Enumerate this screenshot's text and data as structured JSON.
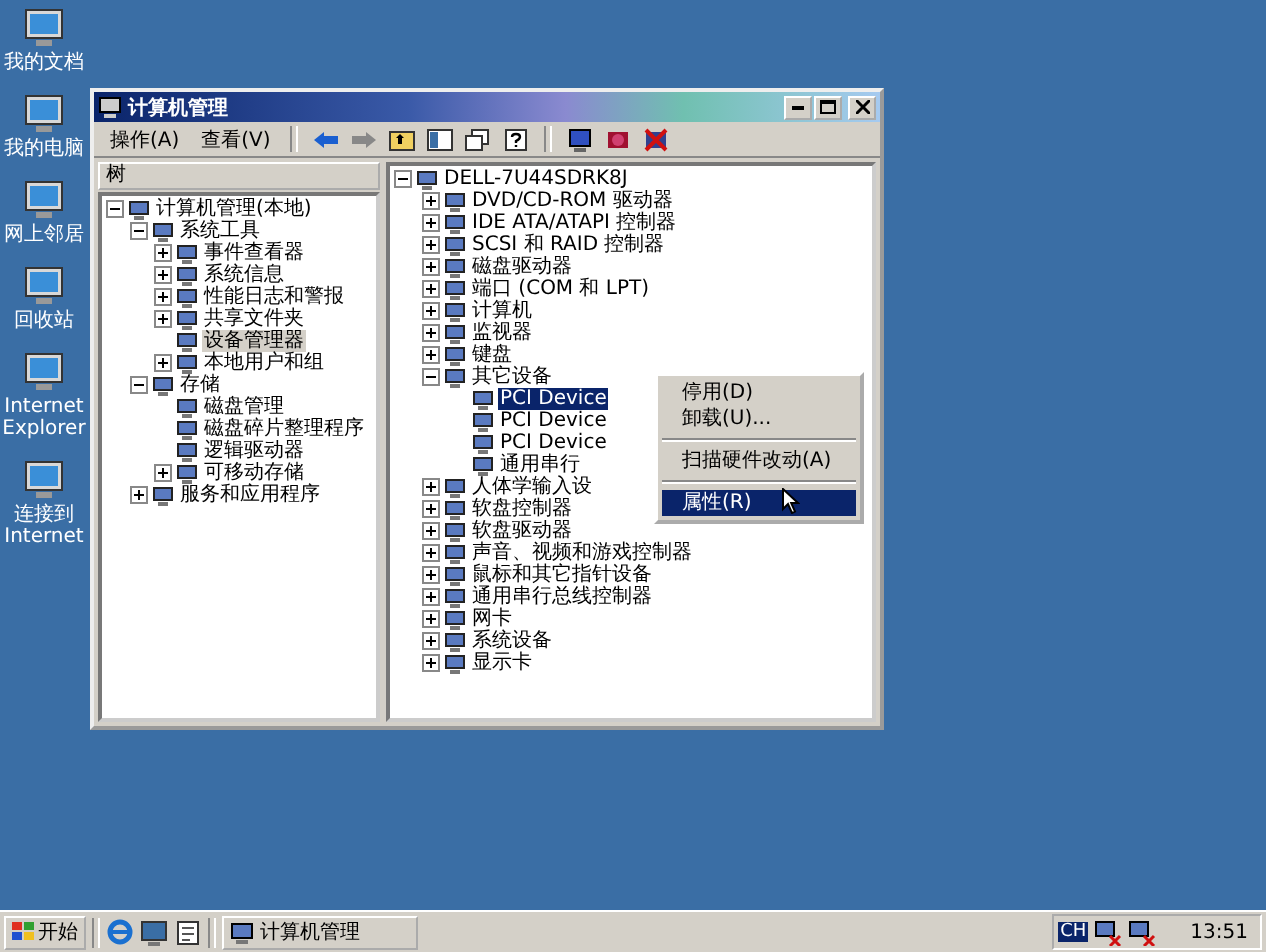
{
  "desktop_icons": [
    {
      "label": "我的文档"
    },
    {
      "label": "我的电脑"
    },
    {
      "label": "网上邻居"
    },
    {
      "label": "回收站"
    },
    {
      "label": "Internet Explorer"
    },
    {
      "label": "连接到 Internet"
    }
  ],
  "window": {
    "title": "计算机管理"
  },
  "menu": [
    "操作(A)",
    "查看(V)"
  ],
  "pane_header": "树",
  "left_tree": [
    {
      "label": "计算机管理(本地)",
      "expanded": true,
      "selected": false,
      "children": [
        {
          "label": "系统工具",
          "expanded": true,
          "selected": false,
          "children": [
            {
              "label": "事件查看器",
              "expanded": false,
              "selected": false
            },
            {
              "label": "系统信息",
              "expanded": false,
              "selected": false
            },
            {
              "label": "性能日志和警报",
              "expanded": false,
              "selected": false
            },
            {
              "label": "共享文件夹",
              "expanded": false,
              "selected": false
            },
            {
              "label": "设备管理器",
              "selected": true
            },
            {
              "label": "本地用户和组",
              "expanded": false,
              "selected": false
            }
          ]
        },
        {
          "label": "存储",
          "expanded": true,
          "selected": false,
          "children": [
            {
              "label": "磁盘管理",
              "selected": false
            },
            {
              "label": "磁盘碎片整理程序",
              "selected": false
            },
            {
              "label": "逻辑驱动器",
              "selected": false
            },
            {
              "label": "可移动存储",
              "expanded": false,
              "selected": false
            }
          ]
        },
        {
          "label": "服务和应用程序",
          "expanded": false,
          "selected": false
        }
      ]
    }
  ],
  "right_tree": [
    {
      "label": "DELL-7U44SDRK8J",
      "expanded": true,
      "selected": false,
      "children": [
        {
          "label": "DVD/CD-ROM 驱动器",
          "expanded": false,
          "selected": false
        },
        {
          "label": "IDE ATA/ATAPI 控制器",
          "expanded": false,
          "selected": false
        },
        {
          "label": "SCSI 和 RAID 控制器",
          "expanded": false,
          "selected": false
        },
        {
          "label": "磁盘驱动器",
          "expanded": false,
          "selected": false
        },
        {
          "label": "端口 (COM 和 LPT)",
          "expanded": false,
          "selected": false
        },
        {
          "label": "计算机",
          "expanded": false,
          "selected": false
        },
        {
          "label": "监视器",
          "expanded": false,
          "selected": false
        },
        {
          "label": "键盘",
          "expanded": false,
          "selected": false
        },
        {
          "label": "其它设备",
          "expanded": true,
          "selected": false,
          "children": [
            {
              "label": "PCI Device",
              "selected": true
            },
            {
              "label": "PCI Device",
              "selected": false
            },
            {
              "label": "PCI Device",
              "selected": false
            },
            {
              "label": "通用串行",
              "selected": false
            }
          ]
        },
        {
          "label": "人体学输入设",
          "expanded": false,
          "selected": false
        },
        {
          "label": "软盘控制器",
          "expanded": false,
          "selected": false
        },
        {
          "label": "软盘驱动器",
          "expanded": false,
          "selected": false
        },
        {
          "label": "声音、视频和游戏控制器",
          "expanded": false,
          "selected": false
        },
        {
          "label": "鼠标和其它指针设备",
          "expanded": false,
          "selected": false
        },
        {
          "label": "通用串行总线控制器",
          "expanded": false,
          "selected": false
        },
        {
          "label": "网卡",
          "expanded": false,
          "selected": false
        },
        {
          "label": "系统设备",
          "expanded": false,
          "selected": false
        },
        {
          "label": "显示卡",
          "expanded": false,
          "selected": false
        }
      ]
    }
  ],
  "context_menu": [
    {
      "kind": "item",
      "label": "停用(D)",
      "selected": false
    },
    {
      "kind": "item",
      "label": "卸载(U)...",
      "selected": false
    },
    {
      "kind": "separator"
    },
    {
      "kind": "item",
      "label": "扫描硬件改动(A)",
      "selected": false
    },
    {
      "kind": "separator"
    },
    {
      "kind": "item",
      "label": "属性(R)",
      "selected": true
    }
  ],
  "taskbar": {
    "start": "开始",
    "tasks": [
      {
        "label": "计算机管理",
        "selected": false
      }
    ],
    "language": "CH",
    "clock": "13:51"
  }
}
